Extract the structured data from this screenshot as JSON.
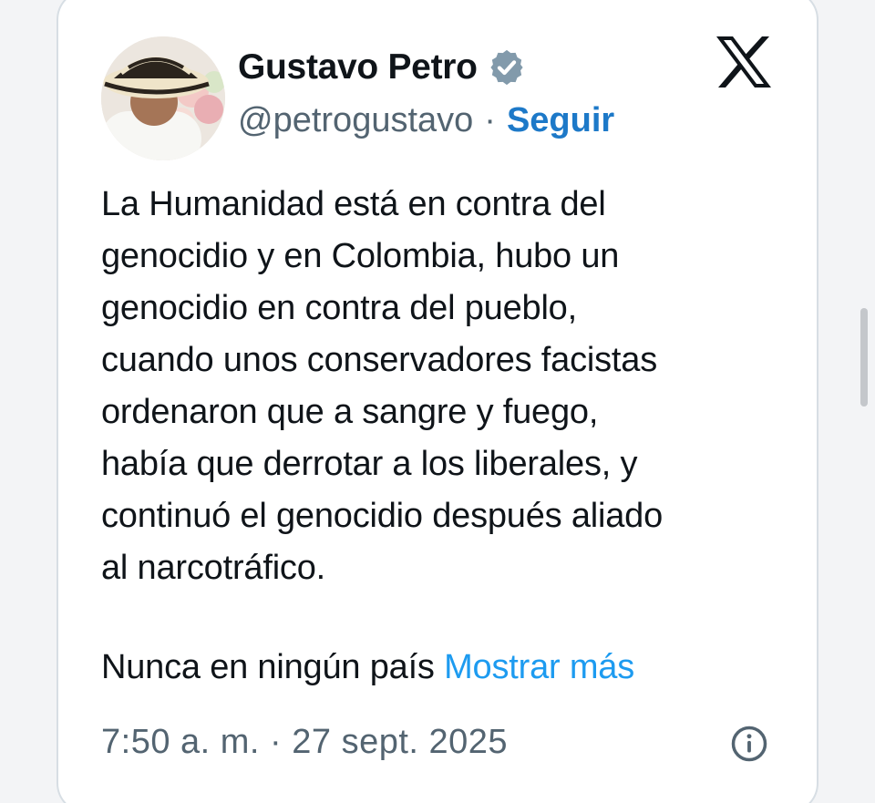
{
  "tweet": {
    "author": {
      "display_name": "Gustavo Petro",
      "handle": "@petrogustavo",
      "separator": "·",
      "follow_label": "Seguir",
      "verified_icon": "verified-badge-icon"
    },
    "platform_logo": "x-logo-icon",
    "text": "La Humanidad está en contra del\ngenocidio y en Colombia, hubo un\ngenocidio en contra del pueblo,\ncuando unos conservadores facistas\nordenaron que a sangre y fuego,\nhabía que derrotar a los liberales, y\ncontinuó el genocidio después aliado\nal narcotráfico.",
    "text_continued": "Nunca en ningún país",
    "show_more_label": "Mostrar más",
    "timestamp": "7:50 a. m. · 27 sept. 2025",
    "info_icon": "info-icon"
  },
  "colors": {
    "primary_text": "#0f1419",
    "secondary_text": "#536471",
    "follow_link": "#1d79c8",
    "show_more_link": "#1d9bf0",
    "verified_badge": "#829aab",
    "card_border": "#d7dee4"
  }
}
